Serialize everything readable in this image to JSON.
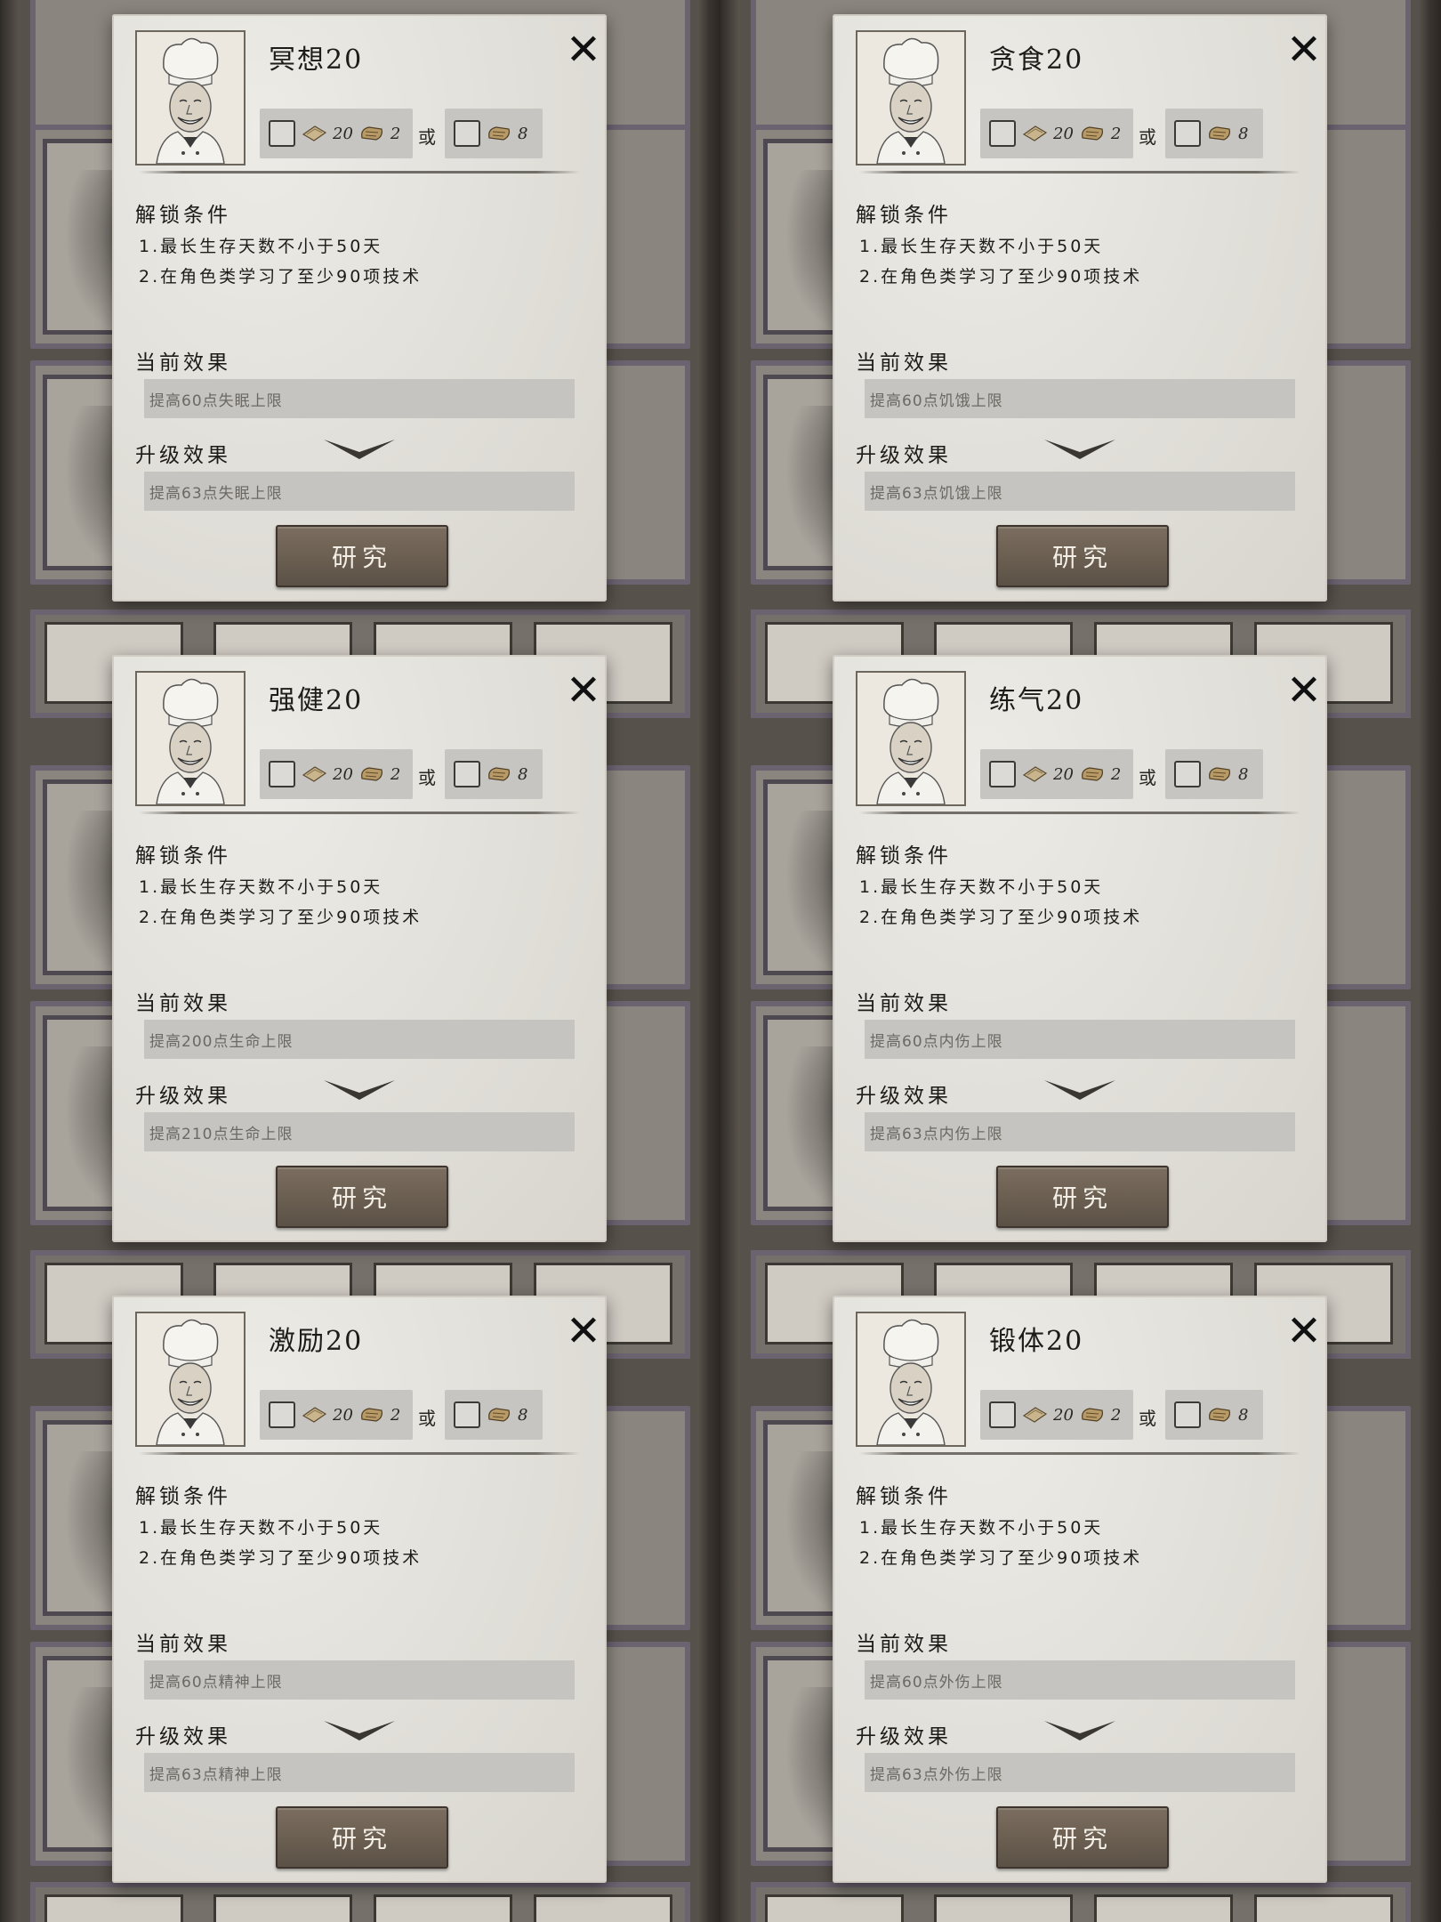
{
  "shared": {
    "or_label": "或",
    "cost_a_num1": "20",
    "cost_a_num2": "2",
    "cost_b_num": "8",
    "unlock_title": "解锁条件",
    "unlock_line1": "1.最长生存天数不小于50天",
    "unlock_line2": "2.在角色类学习了至少90项技术",
    "current_label": "当前效果",
    "upgrade_label": "升级效果",
    "research_label": "研究",
    "close_symbol": "✕"
  },
  "dialogs": [
    {
      "title": "冥想20",
      "current": "提高60点失眠上限",
      "upgrade": "提高63点失眠上限"
    },
    {
      "title": "贪食20",
      "current": "提高60点饥饿上限",
      "upgrade": "提高63点饥饿上限"
    },
    {
      "title": "强健20",
      "current": "提高200点生命上限",
      "upgrade": "提高210点生命上限"
    },
    {
      "title": "练气20",
      "current": "提高60点内伤上限",
      "upgrade": "提高63点内伤上限"
    },
    {
      "title": "激励20",
      "current": "提高60点精神上限",
      "upgrade": "提高63点精神上限"
    },
    {
      "title": "锻体20",
      "current": "提高60点外伤上限",
      "upgrade": "提高63点外伤上限"
    }
  ],
  "icons": {
    "close": "close-icon",
    "checkbox": "checkbox-icon",
    "scroll_a": "paper-scroll-icon",
    "scroll_b": "rolled-scroll-icon",
    "expand": "chevron-down-icon",
    "portrait": "chef-portrait"
  }
}
